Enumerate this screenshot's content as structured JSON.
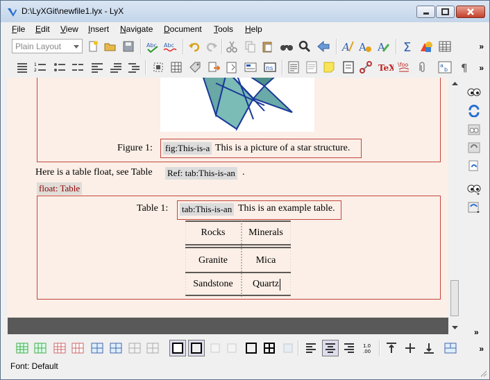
{
  "window": {
    "title": "D:\\LyXGit\\newfile1.lyx - LyX"
  },
  "menu": [
    "File",
    "Edit",
    "View",
    "Insert",
    "Navigate",
    "Document",
    "Tools",
    "Help"
  ],
  "toolbar": {
    "layout_combo": "Plain Layout",
    "more": "»"
  },
  "document": {
    "figure_label": "Figure 1:",
    "figure_ref": "fig:This-is-a",
    "figure_caption": "This is a picture of a star structure.",
    "body_text": "Here is a table float, see Table",
    "ref_button": "Ref: tab:This-is-an",
    "body_end": ".",
    "float_label": "float: Table",
    "table_label": "Table 1:",
    "table_ref": "tab:This-is-an",
    "table_caption": "This is an example table.",
    "table": {
      "header": [
        "Rocks",
        "Minerals"
      ],
      "rows": [
        [
          "Granite",
          "Mica"
        ],
        [
          "Sandstone",
          "Quartz"
        ]
      ]
    }
  },
  "status": {
    "font": "Font: Default"
  }
}
